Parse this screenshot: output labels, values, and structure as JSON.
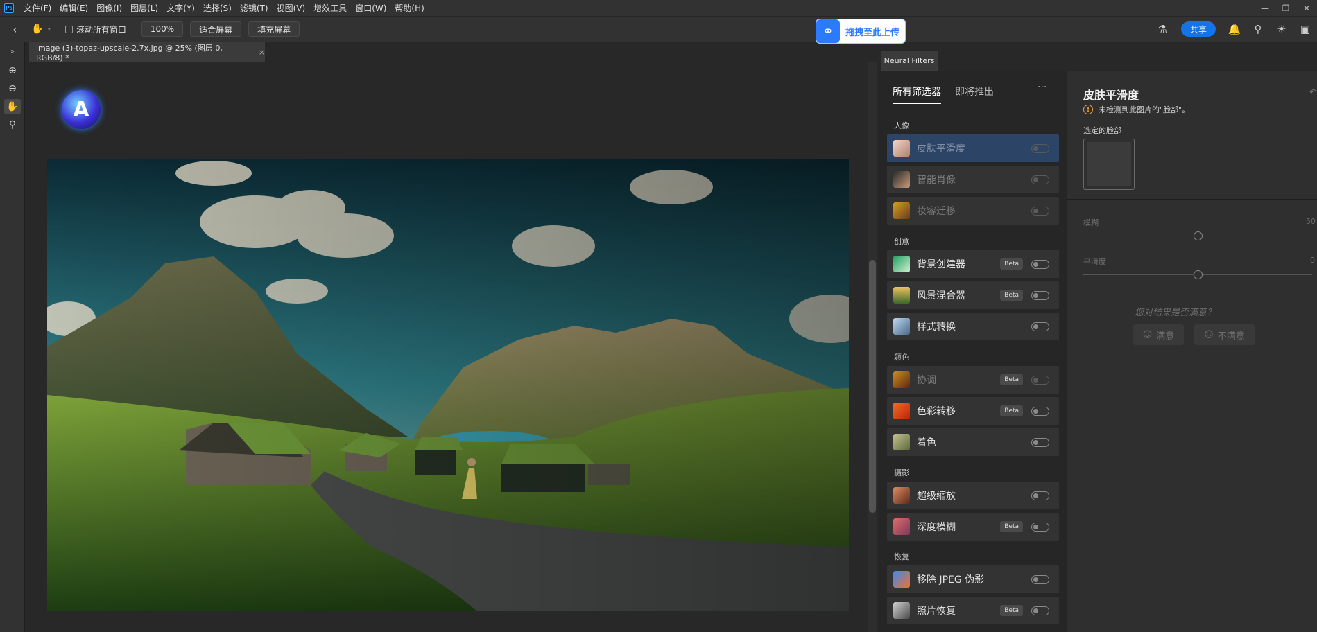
{
  "menubar": {
    "logo": "Ps",
    "items": [
      "文件(F)",
      "编辑(E)",
      "图像(I)",
      "图层(L)",
      "文字(Y)",
      "选择(S)",
      "滤镜(T)",
      "视图(V)",
      "增效工具",
      "窗口(W)",
      "帮助(H)"
    ],
    "window_controls": [
      "—",
      "❐",
      "✕"
    ]
  },
  "options": {
    "scroll_all": "滚动所有窗口",
    "zoom": "100%",
    "fit": "适合屏幕",
    "fill": "填充屏幕",
    "upload_label": "拖拽至此上传",
    "share": "共享"
  },
  "document": {
    "tab_title": "image (3)-topaz-upscale-2.7x.jpg @ 25% (图层 0, RGB/8) *",
    "close": "×",
    "badge_letter": "A"
  },
  "neural_filters": {
    "panel_tab": "Neural Filters",
    "tabs": [
      "所有筛选器",
      "即将推出"
    ],
    "more": "···",
    "categories": [
      "人像",
      "创意",
      "颜色",
      "摄影",
      "恢复"
    ],
    "filters": [
      {
        "label": "皮肤平滑度",
        "beta": "",
        "state": "selected"
      },
      {
        "label": "智能肖像",
        "beta": "",
        "state": "dim"
      },
      {
        "label": "妆容迁移",
        "beta": "",
        "state": "dim"
      },
      {
        "label": "背景创建器",
        "beta": "Beta",
        "state": "normal"
      },
      {
        "label": "风景混合器",
        "beta": "Beta",
        "state": "normal"
      },
      {
        "label": "样式转换",
        "beta": "",
        "state": "normal"
      },
      {
        "label": "协调",
        "beta": "Beta",
        "state": "dim"
      },
      {
        "label": "色彩转移",
        "beta": "Beta",
        "state": "normal"
      },
      {
        "label": "着色",
        "beta": "",
        "state": "normal"
      },
      {
        "label": "超级缩放",
        "beta": "",
        "state": "normal"
      },
      {
        "label": "深度模糊",
        "beta": "Beta",
        "state": "normal"
      },
      {
        "label": "移除 JPEG 伪影",
        "beta": "",
        "state": "normal"
      },
      {
        "label": "照片恢复",
        "beta": "Beta",
        "state": "normal"
      }
    ]
  },
  "detail": {
    "title": "皮肤平滑度",
    "warning": "未检测到此图片的\"脸部\"。",
    "faces_label": "选定的脸部",
    "slider1_label": "模糊",
    "slider1_value": "50",
    "slider2_label": "平滑度",
    "slider2_value": "0",
    "feedback_question": "您对结果是否满意？",
    "satisfied": "满意",
    "unsatisfied": "不满意"
  }
}
